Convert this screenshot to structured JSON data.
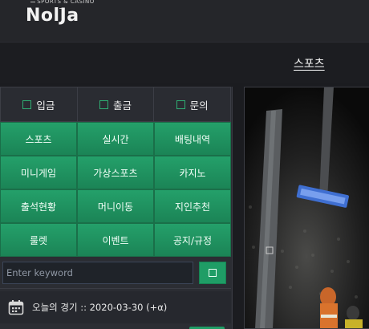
{
  "header": {
    "logo_tag": "SPORTS & CASINO",
    "logo_text": "NolJa"
  },
  "nav": {
    "active_item": "스포츠"
  },
  "quick_actions": [
    {
      "label": "입금",
      "icon": "square-icon"
    },
    {
      "label": "출금",
      "icon": "square-icon"
    },
    {
      "label": "문의",
      "icon": "square-icon"
    }
  ],
  "menu_grid": [
    "스포츠",
    "실시간",
    "배팅내역",
    "미니게임",
    "가상스포츠",
    "카지노",
    "출석현황",
    "머니이동",
    "지인추천",
    "룰렛",
    "이벤트",
    "공지/규정"
  ],
  "search": {
    "placeholder": "Enter keyword",
    "button_icon": "square-icon"
  },
  "today": {
    "icon": "calendar-icon",
    "text": "오늘의 경기 :: 2020-03-30 (+α)"
  },
  "hero": {
    "description_icon": "stadium-photo"
  },
  "colors": {
    "accent_green": "#1f9d66",
    "panel_bg": "#2b2d33",
    "header_bg": "#25262a"
  }
}
